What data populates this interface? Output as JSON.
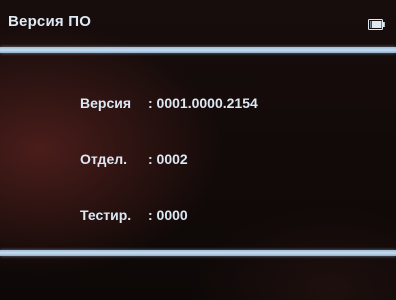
{
  "header": {
    "title": "Версия ПО",
    "battery_icon": "battery-icon"
  },
  "info": {
    "rows": [
      {
        "label": "Версия",
        "value": ": 0001.0000.2154"
      },
      {
        "label": "Отдел.",
        "value": ": 0002"
      },
      {
        "label": "Тестир.",
        "value": ": 0000"
      }
    ]
  },
  "colors": {
    "text": "#dde8f3",
    "divider": "#c9dbee",
    "background": "#120a09"
  }
}
